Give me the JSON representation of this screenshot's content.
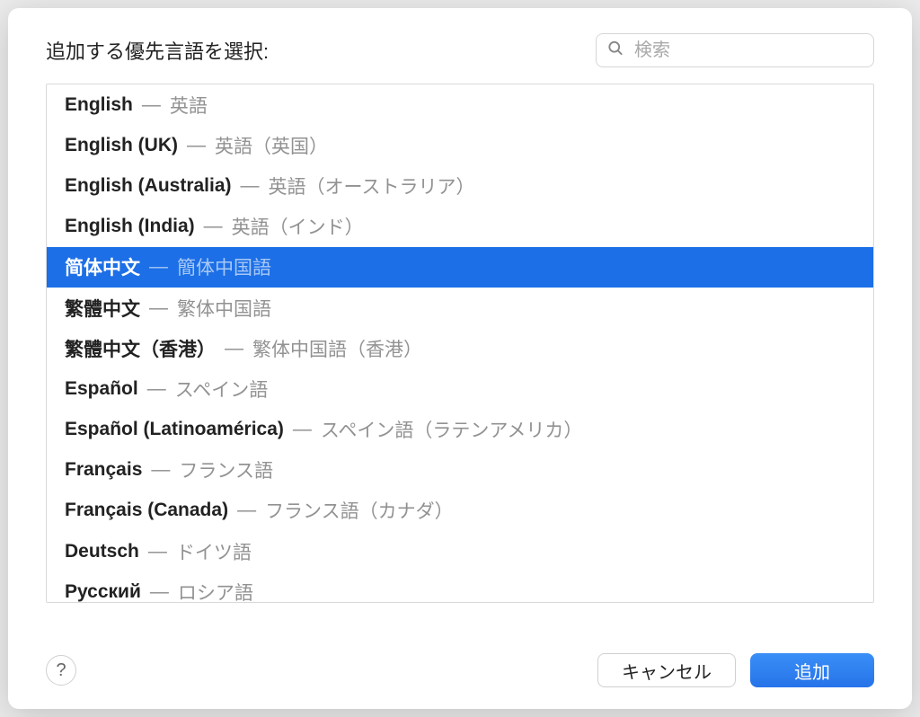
{
  "title": "追加する優先言語を選択:",
  "search": {
    "placeholder": "検索"
  },
  "languages": [
    {
      "native": "English",
      "local": "英語",
      "selected": false
    },
    {
      "native": "English (UK)",
      "local": "英語（英国）",
      "selected": false
    },
    {
      "native": "English (Australia)",
      "local": "英語（オーストラリア）",
      "selected": false
    },
    {
      "native": "English (India)",
      "local": "英語（インド）",
      "selected": false
    },
    {
      "native": "简体中文",
      "local": "簡体中国語",
      "selected": true
    },
    {
      "native": "繁體中文",
      "local": "繁体中国語",
      "selected": false
    },
    {
      "native": "繁體中文（香港）",
      "local": "繁体中国語（香港）",
      "selected": false
    },
    {
      "native": "Español",
      "local": "スペイン語",
      "selected": false
    },
    {
      "native": "Español (Latinoamérica)",
      "local": "スペイン語（ラテンアメリカ）",
      "selected": false
    },
    {
      "native": "Français",
      "local": "フランス語",
      "selected": false
    },
    {
      "native": "Français (Canada)",
      "local": "フランス語（カナダ）",
      "selected": false
    },
    {
      "native": "Deutsch",
      "local": "ドイツ語",
      "selected": false
    },
    {
      "native": "Русский",
      "local": "ロシア語",
      "selected": false
    }
  ],
  "separator": "—",
  "footer": {
    "help_label": "?",
    "cancel_label": "キャンセル",
    "add_label": "追加"
  }
}
